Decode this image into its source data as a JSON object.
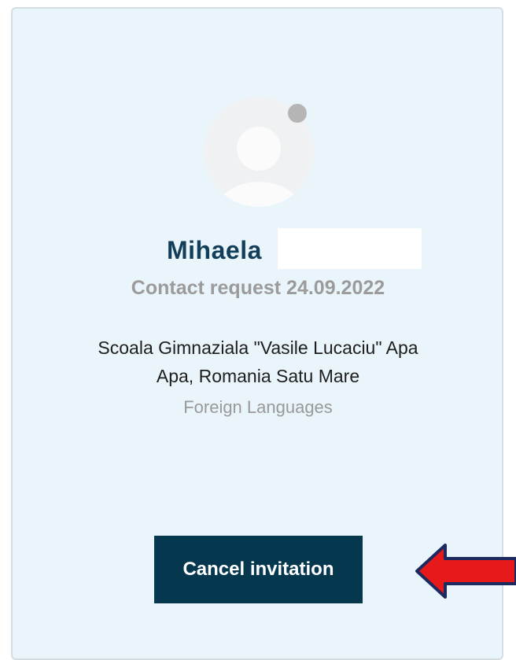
{
  "contact": {
    "first_name": "Mihaela",
    "request_text": "Contact request 24.09.2022",
    "school_line1": "Scoala Gimnaziala \"Vasile Lucaciu\" Apa",
    "school_line2": "Apa, Romania Satu Mare",
    "subject": "Foreign Languages",
    "status": "offline"
  },
  "actions": {
    "cancel_label": "Cancel invitation"
  },
  "annotation": {
    "arrow_color": "#e8191a",
    "arrow_outline": "#1d2a60",
    "arrow_direction": "left"
  },
  "colors": {
    "card_bg": "#eaf5fb",
    "name": "#133e5a",
    "button_bg": "#05384f"
  },
  "icons": {
    "avatar": "user-placeholder-icon",
    "status": "status-dot-icon",
    "annotation": "red-arrow-icon"
  }
}
